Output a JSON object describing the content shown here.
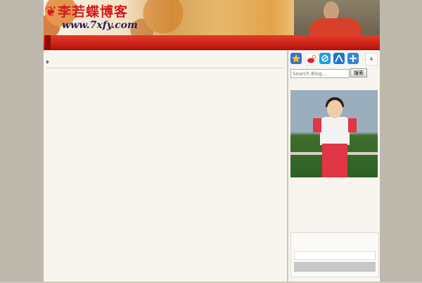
{
  "header": {
    "logo_text": "李若蝶博客",
    "logo_url": "www.7xfy.com",
    "promo_line1": "",
    "promo_line2": ""
  },
  "nav": {
    "items": [
      {
        "label": ""
      },
      {
        "label": ""
      },
      {
        "label": ""
      },
      {
        "label": ""
      },
      {
        "label": ""
      },
      {
        "label": ""
      }
    ],
    "right_label": ""
  },
  "post": {
    "title": "",
    "lines": [
      {
        "text": ""
      },
      {
        "text": ""
      },
      {
        "text": ""
      },
      {
        "text": ""
      },
      {
        "text": ""
      },
      {
        "text": ""
      },
      {
        "text": ""
      },
      {
        "text": ""
      },
      {
        "text": ""
      },
      {
        "text": ""
      },
      {
        "text": ""
      },
      {
        "text": ""
      },
      {
        "text": ""
      },
      {
        "text": ""
      },
      {
        "text": ""
      },
      {
        "text": ""
      },
      {
        "text": ""
      },
      {
        "text": ""
      },
      {
        "text": ""
      },
      {
        "text": ""
      },
      {
        "text": ""
      }
    ]
  },
  "sidebar": {
    "share_count": "4",
    "search_placeholder": "Search Blog...",
    "search_button": "搜索",
    "profile_lines": [
      {
        "text": ""
      },
      {
        "text": ""
      },
      {
        "text": ""
      },
      {
        "text": ""
      },
      {
        "text": ""
      },
      {
        "text": ""
      },
      {
        "text": ""
      }
    ],
    "login_title_1": "",
    "login_title_2": "",
    "login_input_value": "",
    "login_button": ""
  },
  "colors": {
    "nav_red": "#d7221a",
    "title_red": "#c00000",
    "link_blue": "#2a56c9",
    "link_green": "#1a8f1a"
  },
  "icons": [
    "star-icon",
    "weibo-icon",
    "qzone-icon",
    "renren-icon",
    "plus-icon"
  ]
}
